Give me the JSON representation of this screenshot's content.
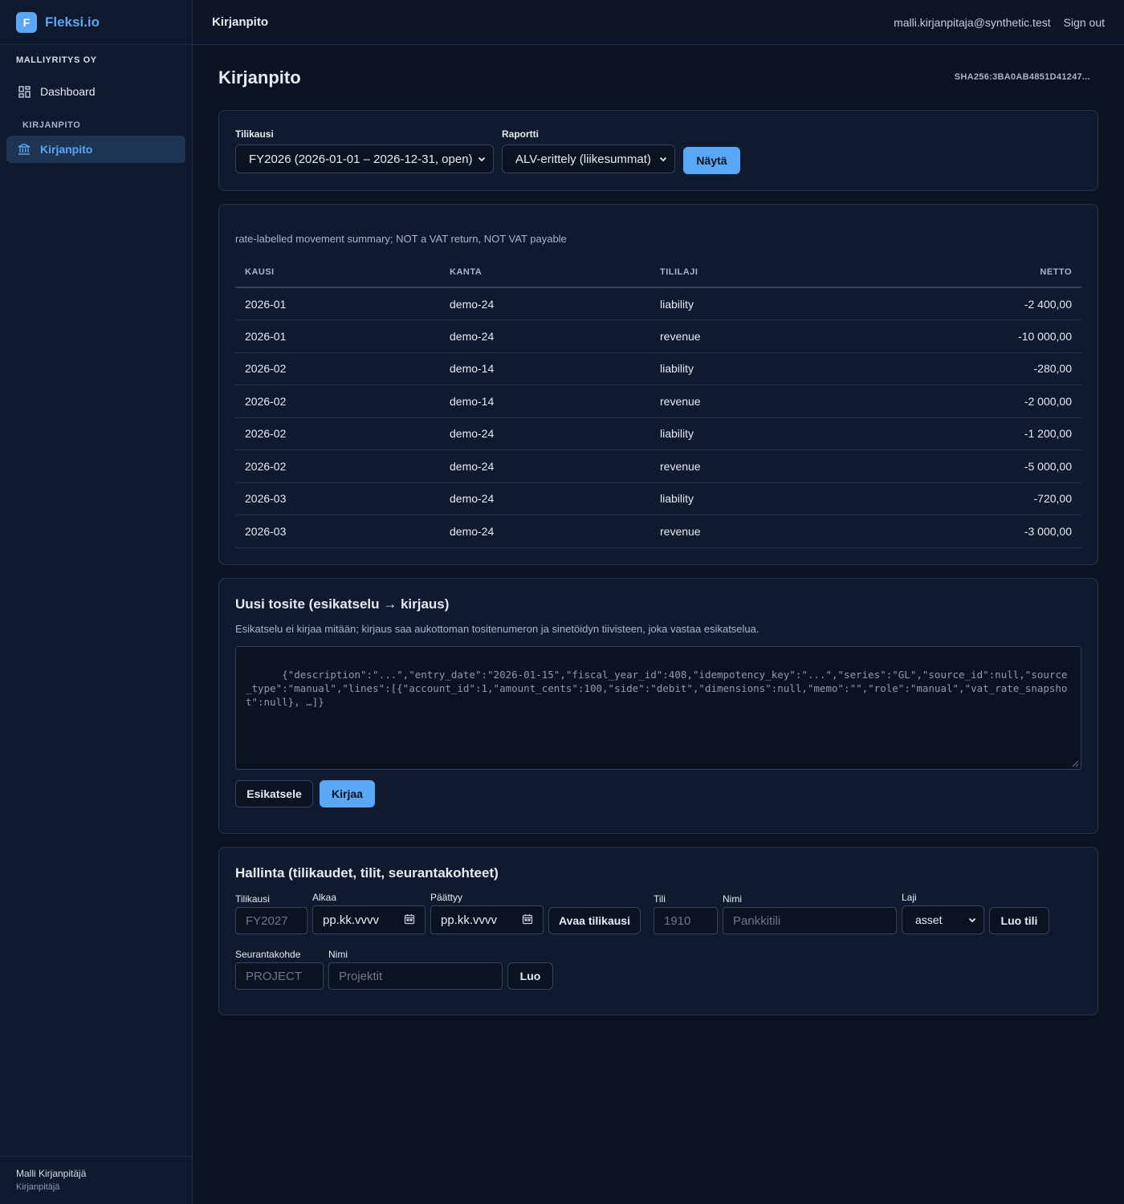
{
  "brand": {
    "logo_letter": "F",
    "name": "Fleksi.io"
  },
  "sidebar": {
    "org": "MALLIYRITYS OY",
    "items": [
      {
        "label": "Dashboard",
        "icon": "dashboard-icon"
      },
      {
        "label": "Kirjanpito",
        "icon": "bank-icon",
        "active": true
      }
    ],
    "section": "KIRJANPITO",
    "user": {
      "name": "Malli Kirjanpitäjä",
      "role": "Kirjanpitäjä"
    }
  },
  "topbar": {
    "title": "Kirjanpito",
    "email": "malli.kirjanpitaja@synthetic.test",
    "sign_out": "Sign out"
  },
  "page": {
    "title": "Kirjanpito",
    "hash": "SHA256:3BA0AB4851D41247..."
  },
  "filters": {
    "fiscal_label": "Tilikausi",
    "fiscal_value": "FY2026 (2026-01-01 – 2026-12-31, open)",
    "report_label": "Raportti",
    "report_value": "ALV-erittely (liikesummat)",
    "show_button": "Näytä"
  },
  "report": {
    "note": "rate-labelled movement summary; NOT a VAT return, NOT VAT payable",
    "columns": [
      "KAUSI",
      "KANTA",
      "TILILAJI",
      "NETTO"
    ],
    "rows": [
      [
        "2026-01",
        "demo-24",
        "liability",
        "-2 400,00"
      ],
      [
        "2026-01",
        "demo-24",
        "revenue",
        "-10 000,00"
      ],
      [
        "2026-02",
        "demo-14",
        "liability",
        "-280,00"
      ],
      [
        "2026-02",
        "demo-14",
        "revenue",
        "-2 000,00"
      ],
      [
        "2026-02",
        "demo-24",
        "liability",
        "-1 200,00"
      ],
      [
        "2026-02",
        "demo-24",
        "revenue",
        "-5 000,00"
      ],
      [
        "2026-03",
        "demo-24",
        "liability",
        "-720,00"
      ],
      [
        "2026-03",
        "demo-24",
        "revenue",
        "-3 000,00"
      ]
    ]
  },
  "voucher": {
    "title": "Uusi tosite (esikatselu → kirjaus)",
    "desc": "Esikatselu ei kirjaa mitään; kirjaus saa aukottoman tositenumeron ja sinetöidyn tiivisteen, joka vastaa esikatselua.",
    "placeholder": "{\"description\":\"...\",\"entry_date\":\"2026-01-15\",\"fiscal_year_id\":408,\"idempotency_key\":\"...\",\"series\":\"GL\",\"source_id\":null,\"source_type\":\"manual\",\"lines\":[{\"account_id\":1,\"amount_cents\":100,\"side\":\"debit\",\"dimensions\":null,\"memo\":\"\",\"role\":\"manual\",\"vat_rate_snapshot\":null}, …]}",
    "preview_button": "Esikatsele",
    "post_button": "Kirjaa"
  },
  "admin": {
    "title": "Hallinta (tilikaudet, tilit, seurantakohteet)",
    "fy_label": "Tilikausi",
    "fy_placeholder": "FY2027",
    "start_label": "Alkaa",
    "start_placeholder": "pp.kk.vvvv",
    "end_label": "Päättyy",
    "end_placeholder": "pp.kk.vvvv",
    "open_fy_button": "Avaa tilikausi",
    "account_label": "Tili",
    "account_placeholder": "1910",
    "name_label": "Nimi",
    "name_placeholder": "Pankkitili",
    "type_label": "Laji",
    "type_value": "asset",
    "create_account_button": "Luo tili",
    "dim_label": "Seurantakohde",
    "dim_placeholder": "PROJECT",
    "dim_name_label": "Nimi",
    "dim_name_placeholder": "Projektit",
    "create_button": "Luo"
  }
}
